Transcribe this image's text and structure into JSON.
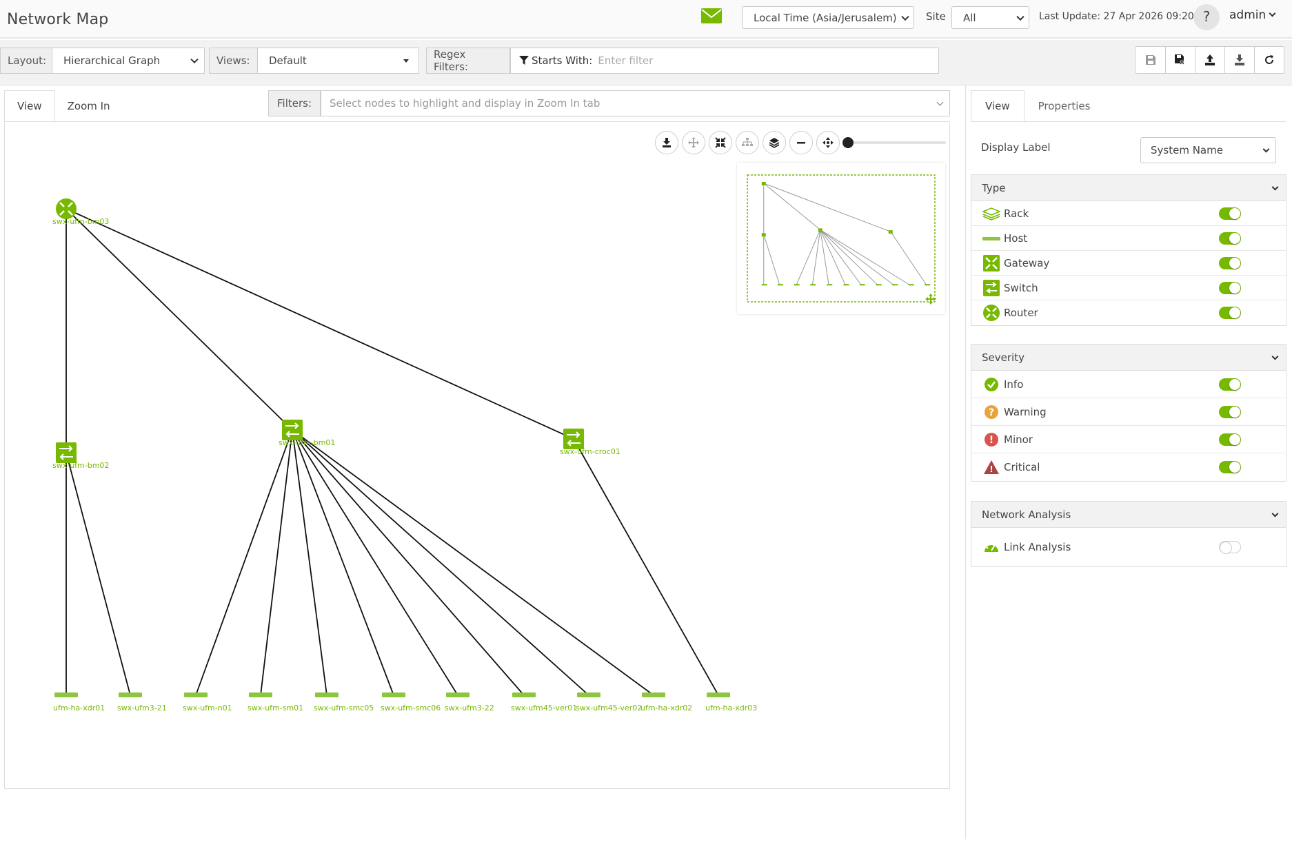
{
  "header": {
    "title": "Network Map",
    "timezone": "Local Time (Asia/Jerusalem)",
    "site_label": "Site",
    "site_value": "All",
    "last_update": "Last Update: 27 Apr 2026 09:20",
    "help": "?",
    "user": "admin"
  },
  "toolbar": {
    "layout_label": "Layout:",
    "layout_value": "Hierarchical Graph",
    "views_label": "Views:",
    "views_value": "Default",
    "regex_label": "Regex Filters:",
    "starts_with": "Starts With:",
    "filter_placeholder": "Enter filter"
  },
  "graph_tabs": [
    "View",
    "Zoom In"
  ],
  "filters": {
    "label": "Filters:",
    "placeholder": "Select nodes to highlight and display in Zoom In tab"
  },
  "nodes": [
    {
      "id": "gw",
      "label": "swx-ufm-bm03",
      "type": "gateway"
    },
    {
      "id": "sw1",
      "label": "swx-ufm-bm02",
      "type": "switch"
    },
    {
      "id": "sw2",
      "label": "swx-ufm-bm01",
      "type": "switch"
    },
    {
      "id": "sw3",
      "label": "swx-ufm-croc01",
      "type": "switch"
    },
    {
      "id": "h1",
      "label": "ufm-ha-xdr01",
      "type": "host"
    },
    {
      "id": "h2",
      "label": "swx-ufm3-21",
      "type": "host"
    },
    {
      "id": "h3",
      "label": "swx-ufm-n01",
      "type": "host"
    },
    {
      "id": "h4",
      "label": "swx-ufm-sm01",
      "type": "host"
    },
    {
      "id": "h5",
      "label": "swx-ufm-smc05",
      "type": "host"
    },
    {
      "id": "h6",
      "label": "swx-ufm-smc06",
      "type": "host"
    },
    {
      "id": "h7",
      "label": "swx-ufm3-22",
      "type": "host"
    },
    {
      "id": "h8",
      "label": "swx-ufm45-ver01",
      "type": "host"
    },
    {
      "id": "h9",
      "label": "swx-ufm45-ver02",
      "type": "host"
    },
    {
      "id": "h10",
      "label": "ufm-ha-xdr02",
      "type": "host"
    },
    {
      "id": "h11",
      "label": "ufm-ha-xdr03",
      "type": "host"
    }
  ],
  "edges": [
    [
      "gw",
      "sw1"
    ],
    [
      "gw",
      "sw2"
    ],
    [
      "gw",
      "sw3"
    ],
    [
      "sw1",
      "h1"
    ],
    [
      "sw1",
      "h2"
    ],
    [
      "sw2",
      "h3"
    ],
    [
      "sw2",
      "h4"
    ],
    [
      "sw2",
      "h5"
    ],
    [
      "sw2",
      "h6"
    ],
    [
      "sw2",
      "h7"
    ],
    [
      "sw2",
      "h8"
    ],
    [
      "sw2",
      "h9"
    ],
    [
      "sw2",
      "h10"
    ],
    [
      "sw3",
      "h11"
    ]
  ],
  "right_panel": {
    "tabs": [
      "View",
      "Properties"
    ],
    "display_label": "Display Label",
    "display_value": "System Name",
    "type_section": {
      "title": "Type",
      "items": [
        {
          "label": "Rack",
          "icon": "rack-icon",
          "on": true
        },
        {
          "label": "Host",
          "icon": "host-icon",
          "on": true
        },
        {
          "label": "Gateway",
          "icon": "gateway-icon",
          "on": true
        },
        {
          "label": "Switch",
          "icon": "switch-icon",
          "on": true
        },
        {
          "label": "Router",
          "icon": "router-icon",
          "on": true
        }
      ]
    },
    "severity_section": {
      "title": "Severity",
      "items": [
        {
          "label": "Info",
          "icon": "info-icon",
          "on": true
        },
        {
          "label": "Warning",
          "icon": "warning-icon",
          "on": true
        },
        {
          "label": "Minor",
          "icon": "minor-icon",
          "on": true
        },
        {
          "label": "Critical",
          "icon": "critical-icon",
          "on": true
        }
      ]
    },
    "analysis_section": {
      "title": "Network Analysis",
      "items": [
        {
          "label": "Link Analysis",
          "icon": "gauge-icon",
          "on": false
        }
      ]
    }
  },
  "colors": {
    "accent": "#76b900",
    "node": "#76b900",
    "label": "#76b900",
    "warning": "#e8a33d",
    "minor": "#d9534f",
    "critical": "#a94442"
  }
}
